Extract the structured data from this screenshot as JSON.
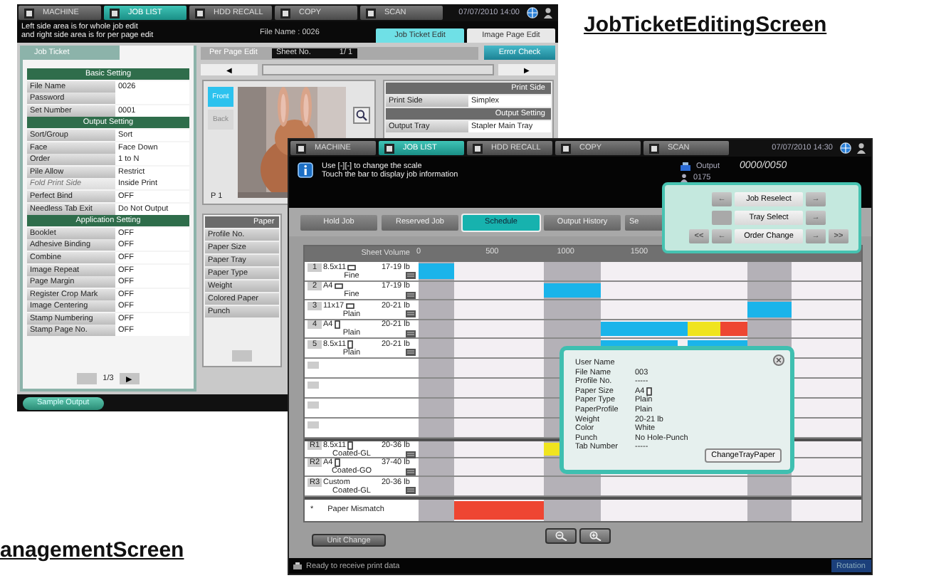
{
  "captions": [
    "JobTicketEditingScreen",
    "anagementScreen"
  ],
  "job_ticket_screen": {
    "nav_tabs": [
      {
        "label": "MACHINE",
        "selected": false
      },
      {
        "label": "JOB LIST",
        "selected": true
      },
      {
        "label": "HDD RECALL",
        "selected": false
      },
      {
        "label": "COPY",
        "selected": false
      },
      {
        "label": "SCAN",
        "selected": false
      }
    ],
    "datetime": "07/07/2010 14:00",
    "message": [
      "Left side area is for whole job edit",
      "and right side area is for per page edit"
    ],
    "file_name": "File Name : 0026",
    "edit_tabs": [
      {
        "label": "Job Ticket Edit",
        "selected": true
      },
      {
        "label": "Image Page Edit",
        "selected": false
      }
    ],
    "job_ticket": {
      "title": "Job Ticket",
      "pager": "1/3",
      "next": "▶",
      "sections": [
        {
          "title": "Basic Setting",
          "rows": [
            {
              "label": "File Name",
              "value": "0026",
              "disabled": false
            },
            {
              "label": "Password",
              "disabled": false
            },
            {
              "label": "Set Number",
              "value": "0001",
              "disabled": false
            }
          ]
        },
        {
          "title": "Output Setting",
          "rows": [
            {
              "label": "Sort/Group",
              "value": "Sort",
              "disabled": false
            },
            {
              "label": "Face",
              "value": "Face Down",
              "disabled": false
            },
            {
              "label": "Order",
              "value": "1 to N",
              "disabled": false
            },
            {
              "label": "Pile Allow",
              "value": "Restrict",
              "disabled": false
            },
            {
              "label": "Fold Print Side",
              "value": "Inside Print",
              "disabled": true
            },
            {
              "label": "Perfect Bind",
              "value": "OFF",
              "disabled": false
            },
            {
              "label": "Needless Tab Exit",
              "value": "Do Not Output",
              "disabled": false
            }
          ]
        },
        {
          "title": "Application Setting",
          "rows": [
            {
              "label": "Booklet",
              "value": "OFF",
              "disabled": false
            },
            {
              "label": "Adhesive Binding",
              "value": "OFF",
              "disabled": false
            },
            {
              "label": "Combine",
              "value": "OFF",
              "disabled": false
            },
            {
              "label": "Image Repeat",
              "value": "OFF",
              "disabled": false
            },
            {
              "label": "Page Margin",
              "value": "OFF",
              "disabled": false
            },
            {
              "label": "Register Crop Mark",
              "value": "OFF",
              "disabled": false
            },
            {
              "label": "Image Centering",
              "value": "OFF",
              "disabled": false
            },
            {
              "label": "Stamp Numbering",
              "value": "OFF",
              "disabled": false
            },
            {
              "label": "Stamp Page No.",
              "value": "OFF",
              "disabled": false
            }
          ]
        }
      ]
    },
    "per_page": {
      "title": "Per Page Edit",
      "sheet_label": "Sheet No.",
      "sheet_value": "1/  1",
      "error_check": "Error Check",
      "prev": "◀",
      "next": "▶",
      "page": "P  1",
      "sides": [
        {
          "label": "Front",
          "selected": true
        },
        {
          "label": "Back",
          "selected": false
        }
      ]
    },
    "print_sections": [
      {
        "title": "Print Side",
        "rows": [
          {
            "label": "Print Side",
            "value": "Simplex"
          }
        ]
      },
      {
        "title": "Output Setting",
        "rows": [
          {
            "label": "Output Tray",
            "value": "Stapler Main Tray"
          }
        ]
      }
    ],
    "paper": {
      "title": "Paper",
      "rows": [
        "Profile No.",
        "Paper Size",
        "Paper Tray",
        "Paper Type",
        "Weight",
        "Colored Paper",
        "Punch"
      ]
    },
    "sample_output": "Sample Output"
  },
  "job_list_screen": {
    "nav_tabs": [
      {
        "label": "MACHINE",
        "selected": false
      },
      {
        "label": "JOB LIST",
        "selected": true
      },
      {
        "label": "HDD RECALL",
        "selected": false
      },
      {
        "label": "COPY",
        "selected": false
      },
      {
        "label": "SCAN",
        "selected": false
      }
    ],
    "datetime": "07/07/2010 14:30",
    "message": [
      "Use [-][-] to change the scale",
      "Touch the bar to display job information"
    ],
    "output": {
      "label": "Output",
      "count": "0000/0050",
      "sub": "0175"
    },
    "list_tabs": [
      {
        "label": "Hold Job",
        "selected": false
      },
      {
        "label": "Reserved Job",
        "selected": false
      },
      {
        "label": "Schedule",
        "selected": true
      },
      {
        "label": "Output History",
        "selected": false
      },
      {
        "label": "Se",
        "selected": false
      }
    ],
    "schedule": {
      "header": "Sheet Volume",
      "ticks": [
        "0",
        "500",
        "1000",
        "1500"
      ],
      "slots": [
        {
          "shaded": true
        },
        {
          "shaded": false
        },
        {
          "shaded": true
        },
        {
          "shaded": false
        },
        {
          "shaded": false
        },
        {
          "shaded": false
        },
        {
          "shaded": false
        },
        {
          "shaded": true
        },
        {
          "shaded": false
        }
      ],
      "rows": [
        {
          "kind": "paper",
          "number": "1",
          "size": "8.5x11",
          "landscape": true,
          "weight": "17-19 lb",
          "type": "Fine",
          "cells": [
            {
              "filled": true,
              "color": "#1ab4ea"
            }
          ]
        },
        {
          "kind": "paper",
          "number": "2",
          "size": "A4",
          "landscape": true,
          "weight": "17-19 lb",
          "type": "Fine",
          "cells": [
            {
              "filled": false
            },
            {
              "filled": false
            },
            {
              "filled": true,
              "color": "#1ab4ea"
            }
          ]
        },
        {
          "kind": "paper",
          "number": "3",
          "size": "11x17",
          "landscape": true,
          "weight": "20-21 lb",
          "type": "Plain",
          "cells": [
            {
              "filled": false
            },
            {
              "filled": false
            },
            {
              "filled": false
            },
            {
              "filled": false
            },
            {
              "filled": false
            },
            {
              "filled": false
            },
            {
              "filled": false
            },
            {
              "filled": true,
              "color": "#1ab4ea"
            }
          ]
        },
        {
          "kind": "paper",
          "number": "4",
          "size": "A4",
          "landscape": false,
          "weight": "20-21 lb",
          "type": "Plain",
          "cells": [
            {
              "filled": false
            },
            {
              "filled": false
            },
            {
              "filled": false
            },
            {
              "filled": true,
              "color": "#1ab4ea"
            },
            {
              "filled": true,
              "color": "#1ab4ea"
            },
            {
              "filled": true,
              "color": "#f0e41e"
            },
            {
              "filled": true,
              "color": "#ee4632"
            }
          ]
        },
        {
          "kind": "paper",
          "number": "5",
          "size": "8.5x11",
          "landscape": false,
          "weight": "20-21 lb",
          "type": "Plain",
          "cells": [
            {
              "filled": false
            },
            {
              "filled": false
            },
            {
              "filled": false
            },
            {
              "filled": true,
              "color": "#1ab4ea"
            },
            {
              "filled": false
            },
            {
              "filled": true,
              "color": "#1ab4ea"
            },
            {
              "filled": true,
              "color": "#1ab4ea"
            }
          ]
        },
        {
          "kind": "empty"
        },
        {
          "kind": "empty"
        },
        {
          "kind": "empty"
        },
        {
          "kind": "empty"
        },
        {
          "kind": "tray",
          "number": "R1",
          "size": "8.5x11",
          "landscape": false,
          "weight": "20-36 lb",
          "type": "Coated-GL",
          "cells": [
            {
              "filled": false
            },
            {
              "filled": false
            },
            {
              "filled": true,
              "color": "#f0e41e"
            }
          ]
        },
        {
          "kind": "tray",
          "number": "R2",
          "size": "A4",
          "landscape": false,
          "weight": "37-40 lb",
          "type": "Coated-GO"
        },
        {
          "kind": "tray",
          "number": "R3",
          "size": "Custom",
          "weight": "20-36 lb",
          "type": "Coated-GL"
        },
        {
          "kind": "mismatch",
          "number": "*",
          "type": "Paper Mismatch",
          "cells": [
            {
              "filled": false
            },
            {
              "filled": true,
              "color": "#ee4632"
            }
          ]
        }
      ]
    },
    "job_menu": [
      [
        {
          "kind": "arrow",
          "label": "←"
        },
        {
          "kind": "text",
          "label": "Job Reselect"
        },
        {
          "kind": "arrow",
          "label": "→"
        }
      ],
      [
        {
          "kind": "blank"
        },
        {
          "kind": "text",
          "label": "Tray Select"
        },
        {
          "kind": "arrow",
          "label": "→"
        }
      ],
      [
        {
          "kind": "arrow",
          "label": "<<"
        },
        {
          "kind": "arrow",
          "label": "←"
        },
        {
          "kind": "text",
          "label": "Order Change"
        },
        {
          "kind": "arrow",
          "label": "→"
        },
        {
          "kind": "arrow",
          "label": ">>"
        }
      ]
    ],
    "job_info": {
      "button": "ChangeTrayPaper",
      "rows": [
        {
          "label": "User Name"
        },
        {
          "label": "File Name",
          "value": "003"
        },
        {
          "label": "Profile No.",
          "value": "-----"
        },
        {
          "label": "Paper Size",
          "value": "A4",
          "landscape": false
        },
        {
          "label": "Paper Type",
          "value": "Plain"
        },
        {
          "label": "PaperProfile",
          "value": "Plain"
        },
        {
          "label": "Weight",
          "value": "20-21 lb"
        },
        {
          "label": "Color",
          "value": "White"
        },
        {
          "label": "Punch",
          "value": "No Hole-Punch"
        },
        {
          "label": "Tab Number",
          "value": "-----"
        }
      ]
    },
    "unit_change": "Unit Change",
    "status": "Ready to receive print data",
    "rotation": "Rotation"
  }
}
